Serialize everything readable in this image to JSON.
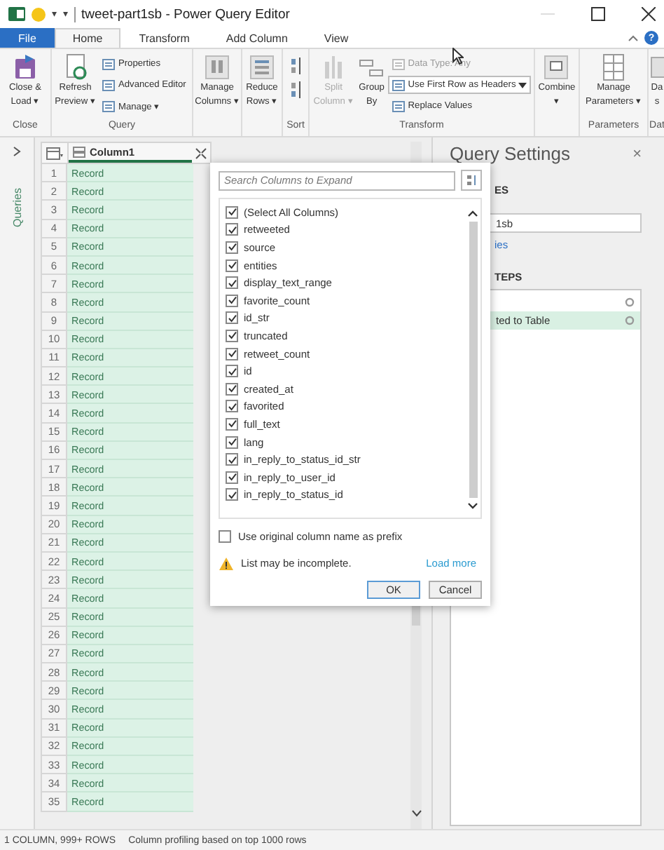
{
  "window": {
    "title": "tweet-part1sb - Power Query Editor",
    "quick_access": [
      "▾",
      "▾"
    ]
  },
  "tabs": [
    {
      "label": "File",
      "kind": "file",
      "selected": false
    },
    {
      "label": "Home",
      "kind": "tab",
      "selected": true
    },
    {
      "label": "Transform",
      "kind": "tab",
      "selected": false
    },
    {
      "label": "Add Column",
      "kind": "tab",
      "selected": false
    },
    {
      "label": "View",
      "kind": "tab",
      "selected": false
    }
  ],
  "help": "?",
  "ribbon": [
    {
      "label": "Close",
      "items": [
        {
          "kind": "large",
          "text": [
            "Close &",
            "Load ▾"
          ],
          "disabled": false
        }
      ]
    },
    {
      "label": "Query",
      "items": [
        {
          "kind": "large",
          "text": [
            "Refresh",
            "Preview ▾"
          ],
          "disabled": false
        },
        {
          "kind": "stack",
          "entries": [
            {
              "text": "Properties",
              "kind": "plain",
              "disabled": false
            },
            {
              "text": "Advanced Editor",
              "kind": "plain",
              "disabled": false
            },
            {
              "text": "Manage ▾",
              "kind": "plain",
              "disabled": false
            }
          ]
        }
      ]
    },
    {
      "items": [
        {
          "kind": "large",
          "text": [
            "Manage",
            "Columns ▾"
          ],
          "disabled": false
        }
      ]
    },
    {
      "items": [
        {
          "kind": "large",
          "text": [
            "Reduce",
            "Rows ▾"
          ],
          "disabled": false
        }
      ]
    },
    {
      "label": "Sort",
      "items": [
        {
          "kind": "sort"
        }
      ]
    },
    {
      "label": "Transform",
      "items": [
        {
          "kind": "large",
          "text": [
            "Split",
            "Column ▾"
          ],
          "disabled": true
        },
        {
          "kind": "large",
          "text": [
            "Group",
            "By"
          ],
          "disabled": false
        },
        {
          "kind": "stack",
          "entries": [
            {
              "text": "Data Type: Any",
              "kind": "plain",
              "disabled": true
            },
            {
              "text": "Use First Row as Headers",
              "kind": "dropdown",
              "disabled": false
            },
            {
              "text": "Replace Values",
              "kind": "plain",
              "disabled": false
            }
          ]
        }
      ]
    },
    {
      "items": [
        {
          "kind": "large",
          "text": [
            "Combine",
            "▾"
          ],
          "disabled": false
        }
      ]
    },
    {
      "label": "Parameters",
      "items": [
        {
          "kind": "large",
          "text": [
            "Manage",
            "Parameters ▾"
          ],
          "disabled": false
        }
      ]
    },
    {
      "label": "Dat",
      "items": [
        {
          "kind": "large",
          "text": [
            "Da",
            "s"
          ],
          "disabled": false
        }
      ]
    }
  ],
  "queries_label": "Queries",
  "table": {
    "columns": [
      {
        "name": "Column1",
        "selected": true
      }
    ],
    "rows": [
      {
        "n": "1",
        "value": "Record"
      },
      {
        "n": "2",
        "value": "Record"
      },
      {
        "n": "3",
        "value": "Record"
      },
      {
        "n": "4",
        "value": "Record"
      },
      {
        "n": "5",
        "value": "Record"
      },
      {
        "n": "6",
        "value": "Record"
      },
      {
        "n": "7",
        "value": "Record"
      },
      {
        "n": "8",
        "value": "Record"
      },
      {
        "n": "9",
        "value": "Record"
      },
      {
        "n": "10",
        "value": "Record"
      },
      {
        "n": "11",
        "value": "Record"
      },
      {
        "n": "12",
        "value": "Record"
      },
      {
        "n": "13",
        "value": "Record"
      },
      {
        "n": "14",
        "value": "Record"
      },
      {
        "n": "15",
        "value": "Record"
      },
      {
        "n": "16",
        "value": "Record"
      },
      {
        "n": "17",
        "value": "Record"
      },
      {
        "n": "18",
        "value": "Record"
      },
      {
        "n": "19",
        "value": "Record"
      },
      {
        "n": "20",
        "value": "Record"
      },
      {
        "n": "21",
        "value": "Record"
      },
      {
        "n": "22",
        "value": "Record"
      },
      {
        "n": "23",
        "value": "Record"
      },
      {
        "n": "24",
        "value": "Record"
      },
      {
        "n": "25",
        "value": "Record"
      },
      {
        "n": "26",
        "value": "Record"
      },
      {
        "n": "27",
        "value": "Record"
      },
      {
        "n": "28",
        "value": "Record"
      },
      {
        "n": "29",
        "value": "Record"
      },
      {
        "n": "30",
        "value": "Record"
      },
      {
        "n": "31",
        "value": "Record"
      },
      {
        "n": "32",
        "value": "Record"
      },
      {
        "n": "33",
        "value": "Record"
      },
      {
        "n": "34",
        "value": "Record"
      },
      {
        "n": "35",
        "value": "Record"
      }
    ]
  },
  "settings": {
    "title": "Query Settings",
    "close": "×",
    "properties_heading": "ES",
    "name_value": "1sb",
    "all_properties": "ies",
    "steps_heading": "TEPS",
    "steps": [
      {
        "selected": false
      },
      {
        "label": "ted to Table",
        "selected": true
      }
    ]
  },
  "expand_dialog": {
    "search": {
      "placeholder": "Search Columns to Expand"
    },
    "columns": [
      {
        "label": "(Select All Columns)",
        "checked": true
      },
      {
        "label": "retweeted",
        "checked": true
      },
      {
        "label": "source",
        "checked": true
      },
      {
        "label": "entities",
        "checked": true
      },
      {
        "label": "display_text_range",
        "checked": true
      },
      {
        "label": "favorite_count",
        "checked": true
      },
      {
        "label": "id_str",
        "checked": true
      },
      {
        "label": "truncated",
        "checked": true
      },
      {
        "label": "retweet_count",
        "checked": true
      },
      {
        "label": "id",
        "checked": true
      },
      {
        "label": "created_at",
        "checked": true
      },
      {
        "label": "favorited",
        "checked": true
      },
      {
        "label": "full_text",
        "checked": true
      },
      {
        "label": "lang",
        "checked": true
      },
      {
        "label": "in_reply_to_status_id_str",
        "checked": true
      },
      {
        "label": "in_reply_to_user_id",
        "checked": true
      },
      {
        "label": "in_reply_to_status_id",
        "checked": true
      }
    ],
    "prefix": {
      "label": "Use original column name as prefix",
      "checked": false
    },
    "warning": "List may be incomplete.",
    "load_more": "Load more",
    "buttons": [
      "OK",
      "Cancel"
    ]
  },
  "status_bar": [
    "1 COLUMN, 999+ ROWS",
    "Column profiling based on top 1000 rows"
  ]
}
